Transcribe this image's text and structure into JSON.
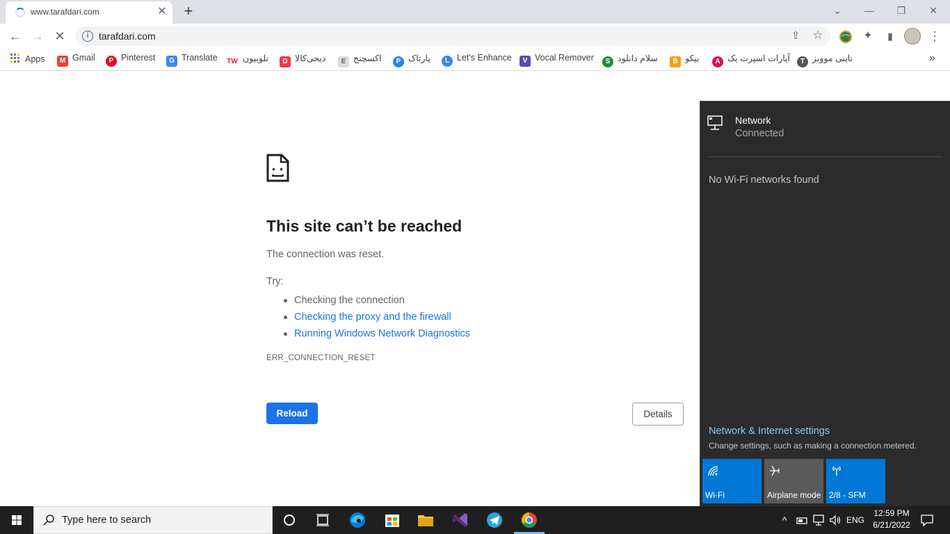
{
  "browser": {
    "tab": {
      "title": "www.tarafdari.com",
      "close_glyph": "✕"
    },
    "new_tab_glyph": "+",
    "window_controls": {
      "tabsearch": "⌄",
      "minimize": "—",
      "restore": "❐",
      "close": "✕"
    },
    "toolbar": {
      "back": "←",
      "forward": "→",
      "stop": "✕",
      "url": "tarafdari.com",
      "info_glyph": "i",
      "share": "⇪",
      "star": "☆",
      "menu": "⋮",
      "ext": "✦",
      "sidepanel": "▮"
    },
    "bookmarks": [
      {
        "label": "Apps",
        "icon": "apps-grid-icon"
      },
      {
        "label": "Gmail",
        "icon": "gmail-icon",
        "glyph": "M",
        "color": "#ea4335"
      },
      {
        "label": "Pinterest",
        "icon": "pinterest-icon",
        "glyph": "P",
        "color": "#e60023"
      },
      {
        "label": "Translate",
        "icon": "google-translate-icon",
        "glyph": "G",
        "color": "#4285f4"
      },
      {
        "label": "تلوبیون",
        "icon": "telewebion-icon",
        "glyph": "TW",
        "color": "#e3262b"
      },
      {
        "label": "دیجی‌کالا",
        "icon": "digikala-icon",
        "glyph": "D",
        "color": "#ef394e"
      },
      {
        "label": "اکسچنج",
        "icon": "exchange-icon",
        "glyph": "E",
        "color": "#9aa0a6"
      },
      {
        "label": "پارتاک",
        "icon": "partak-icon",
        "glyph": "P",
        "color": "#1e88e5"
      },
      {
        "label": "Let's Enhance",
        "icon": "letsenhance-icon",
        "glyph": "L",
        "color": "#3b82f6"
      },
      {
        "label": "Vocal Remover",
        "icon": "vocal-remover-icon",
        "glyph": "V",
        "color": "#5a4ab0"
      },
      {
        "label": "سلام دانلود",
        "icon": "salamdl-icon",
        "glyph": "S",
        "color": "#1b8f3a"
      },
      {
        "label": "بیکو",
        "icon": "bikoo-icon",
        "glyph": "B",
        "color": "#f59f0b"
      },
      {
        "label": "آپارات اسپرت یک",
        "icon": "aparat-icon",
        "glyph": "A",
        "color": "#d6154d"
      },
      {
        "label": "تاپنی مووبز",
        "icon": "film-reel-icon",
        "glyph": "T",
        "color": "#555555"
      }
    ],
    "bookmarks_overflow": "»"
  },
  "error_page": {
    "title": "This site can’t be reached",
    "description": "The connection was reset.",
    "try_label": "Try:",
    "suggestions": [
      {
        "text": "Checking the connection",
        "link": false
      },
      {
        "text": "Checking the proxy and the firewall",
        "link": true
      },
      {
        "text": "Running Windows Network Diagnostics",
        "link": true
      }
    ],
    "error_code": "ERR_CONNECTION_RESET",
    "reload_label": "Reload",
    "details_label": "Details"
  },
  "network_flyout": {
    "network_name": "Network",
    "status": "Connected",
    "no_wifi": "No Wi-Fi networks found",
    "settings_link": "Network & Internet settings",
    "settings_desc": "Change settings, such as making a connection metered.",
    "quick_actions": [
      {
        "label": "Wi-Fi",
        "icon": "wifi-icon",
        "active": true
      },
      {
        "label": "Airplane mode",
        "icon": "airplane-icon",
        "active": false
      },
      {
        "label": "2/8 - SFM",
        "icon": "mobile-hotspot-icon",
        "active": true
      }
    ],
    "colors": {
      "active_tile": "#0078d7",
      "inactive_tile": "#5a5a5a",
      "link": "#8ac5ff"
    }
  },
  "taskbar": {
    "search_placeholder": "Type here to search",
    "language": "ENG",
    "time": "12:59 PM",
    "date": "6/21/2022",
    "tray_chevron": "^"
  }
}
